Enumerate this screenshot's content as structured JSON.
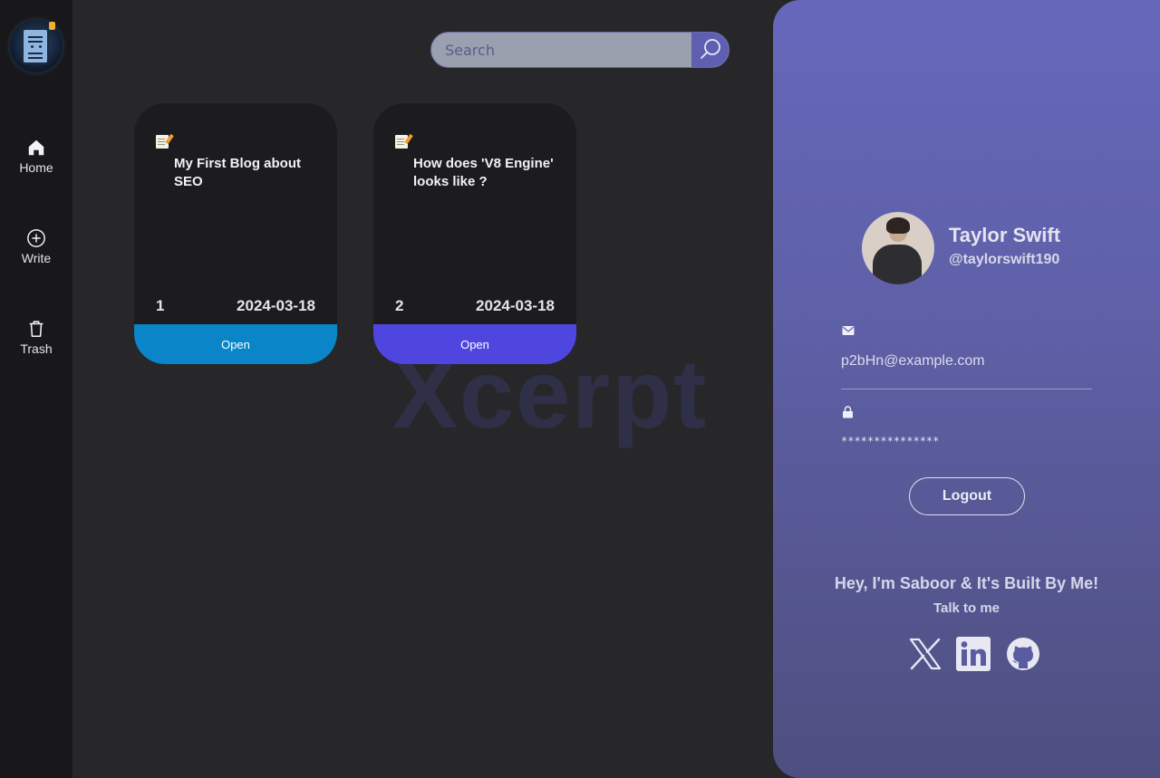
{
  "sidebar": {
    "items": [
      {
        "label": "Home",
        "icon": "home-icon"
      },
      {
        "label": "Write",
        "icon": "plus-circle-icon"
      },
      {
        "label": "Trash",
        "icon": "trash-icon"
      }
    ]
  },
  "search": {
    "placeholder": "Search",
    "icon": "search-icon"
  },
  "watermark": "Xcerpt",
  "posts": [
    {
      "title": "My First Blog about SEO",
      "number": "1",
      "date": "2024-03-18",
      "button": "Open",
      "accent": "#0a86c8",
      "icon": "memo-icon"
    },
    {
      "title": "How does 'V8 Engine' looks like ?",
      "number": "2",
      "date": "2024-03-18",
      "button": "Open",
      "accent": "#4f46e0",
      "icon": "memo-icon"
    }
  ],
  "profile": {
    "name": "Taylor Swift",
    "handle": "@taylorswift190",
    "email": "p2bHn@example.com",
    "password": "***************",
    "logout": "Logout",
    "credit": "Hey, I'm Saboor & It's Built By Me!",
    "talk": "Talk to me",
    "socials": [
      "x-icon",
      "linkedin-icon",
      "github-icon"
    ]
  },
  "colors": {
    "background": "#27272a",
    "sidebar": "#18181a",
    "panel": "#6667bb"
  }
}
